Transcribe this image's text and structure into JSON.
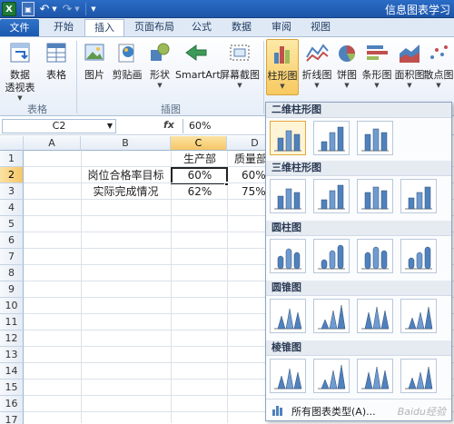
{
  "window": {
    "title": "信息图表学习"
  },
  "quick_access": {
    "logo_letter": "X"
  },
  "tabs": [
    "文件",
    "开始",
    "插入",
    "页面布局",
    "公式",
    "数据",
    "审阅",
    "视图"
  ],
  "active_tab": "插入",
  "ribbon": {
    "buttons": {
      "pivot_line1": "数据",
      "pivot_line2": "透视表",
      "table": "表格",
      "picture": "图片",
      "clipart": "剪贴画",
      "shapes": "形状",
      "smartart": "SmartArt",
      "screenshot": "屏幕截图",
      "column": "柱形图",
      "line": "折线图",
      "pie": "饼图",
      "bar": "条形图",
      "area": "面积图",
      "scatter": "散点图"
    },
    "groups": {
      "tables": "表格",
      "illustrations": "插图"
    }
  },
  "formula_bar": {
    "name_box": "C2",
    "fx": "fx",
    "formula": "60%"
  },
  "grid": {
    "columns": [
      "A",
      "B",
      "C",
      "D"
    ],
    "rows": [
      "1",
      "2",
      "3",
      "4",
      "5",
      "6",
      "7",
      "8",
      "9",
      "10",
      "11",
      "12",
      "13",
      "14",
      "15",
      "16",
      "17"
    ],
    "cells": {
      "C1": "生产部",
      "D1": "质量部",
      "B2": "岗位合格率目标",
      "C2": "60%",
      "D2": "60%",
      "B3": "实际完成情况",
      "C3": "62%",
      "D3": "75%"
    },
    "selected_cell": "C2"
  },
  "gallery": {
    "sections": [
      "二维柱形图",
      "三维柱形图",
      "圆柱图",
      "圆锥图",
      "棱锥图"
    ],
    "all_types": "所有图表类型(A)...",
    "watermark": "Baidu经验"
  },
  "colors": {
    "accent": "#2a6cc6",
    "ribbon_highlight": "#f7c960",
    "bar_blue": "#4f81bd"
  }
}
